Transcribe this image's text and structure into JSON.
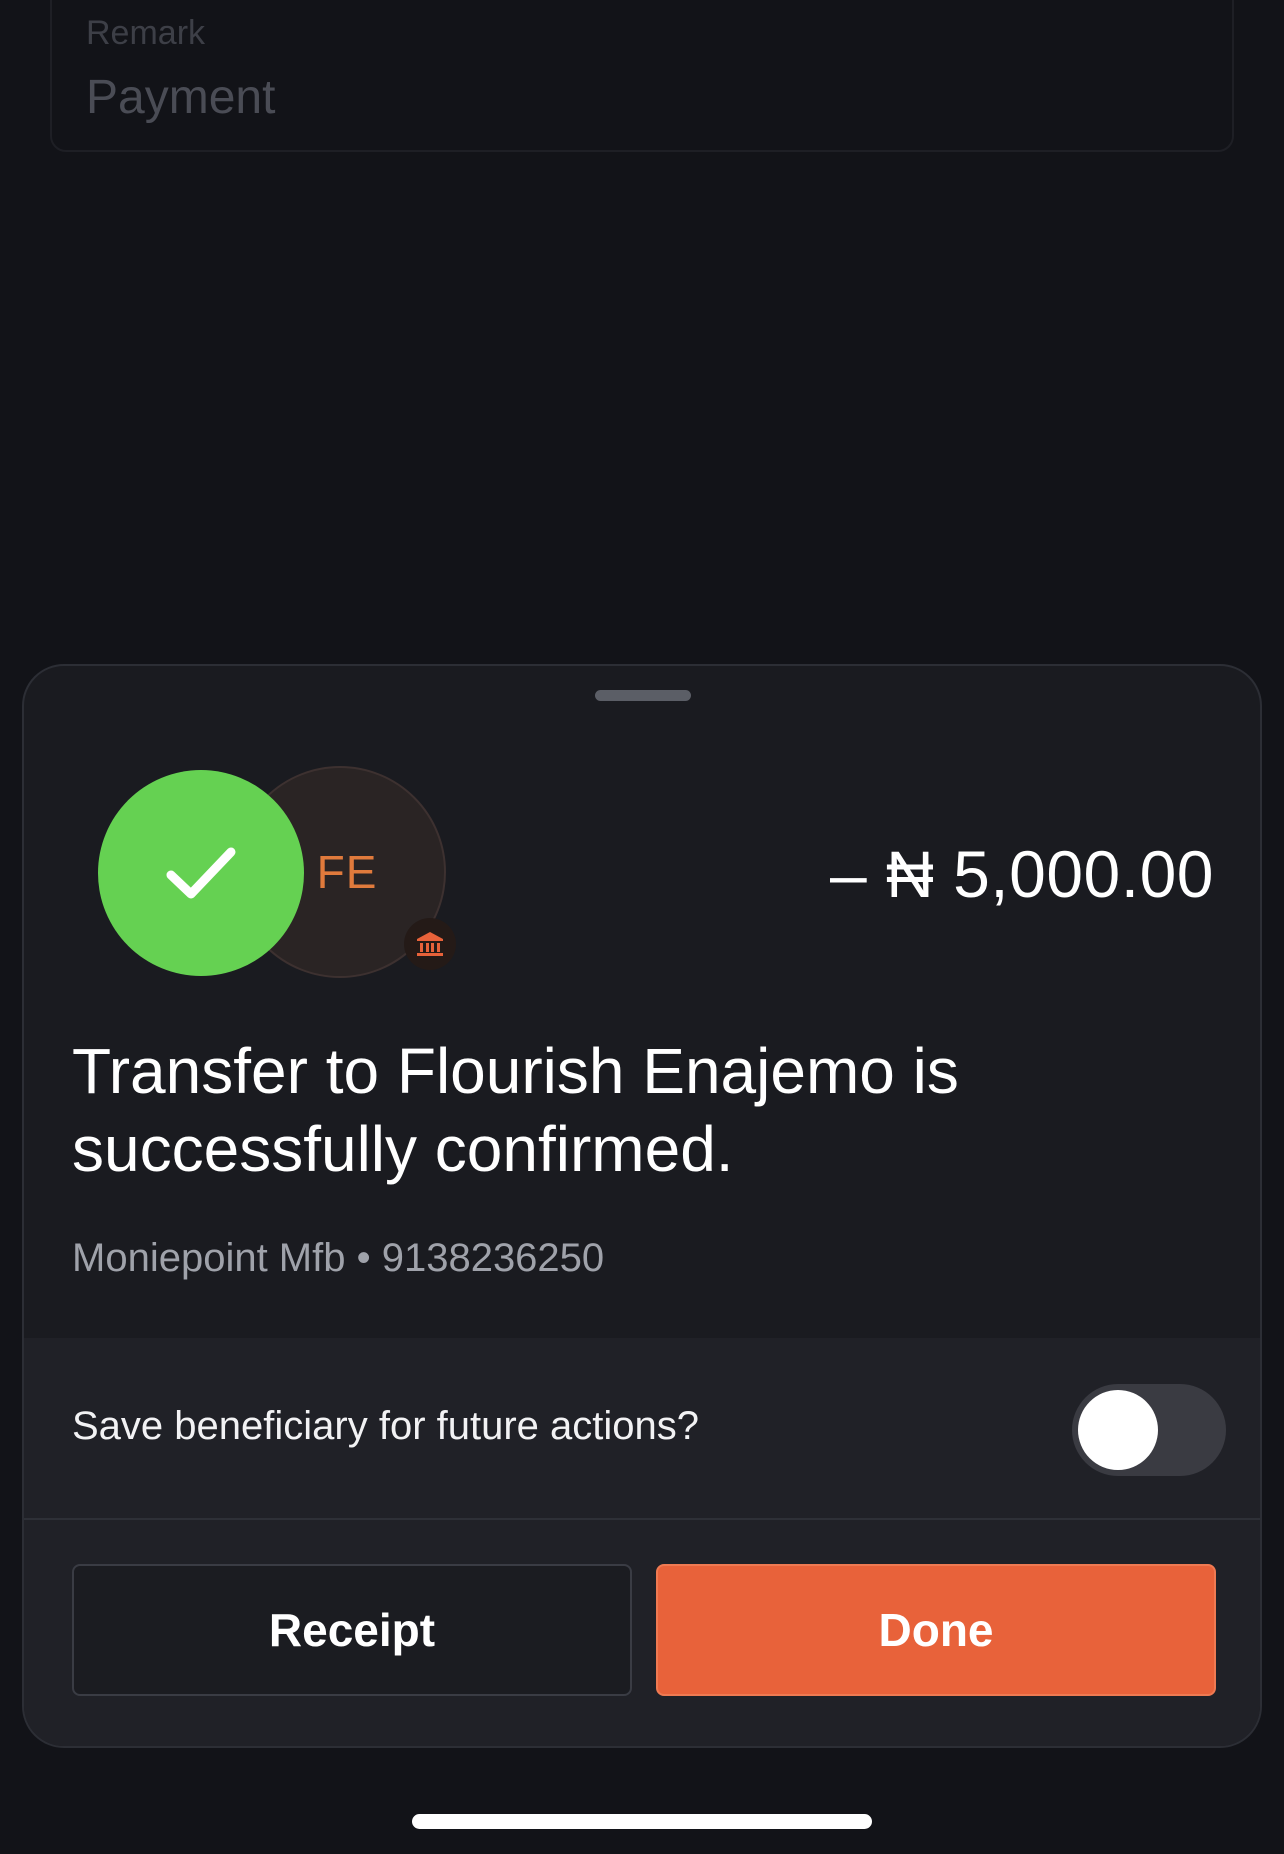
{
  "background_form": {
    "remark_label": "Remark",
    "remark_value": "Payment"
  },
  "sheet": {
    "initials": "FE",
    "amount": "– ₦ 5,000.00",
    "message": "Transfer to Flourish Enajemo is successfully confirmed.",
    "bank_info": "Moniepoint Mfb • 9138236250",
    "save_beneficiary_label": "Save beneficiary for future actions?",
    "save_beneficiary_enabled": false,
    "receipt_label": "Receipt",
    "done_label": "Done"
  },
  "colors": {
    "success": "#65d152",
    "accent": "#e8623a",
    "initials": "#e07a3c",
    "background": "#121318",
    "sheet": "#1a1b20"
  },
  "icons": {
    "success": "checkmark-icon",
    "bank": "bank-icon"
  }
}
